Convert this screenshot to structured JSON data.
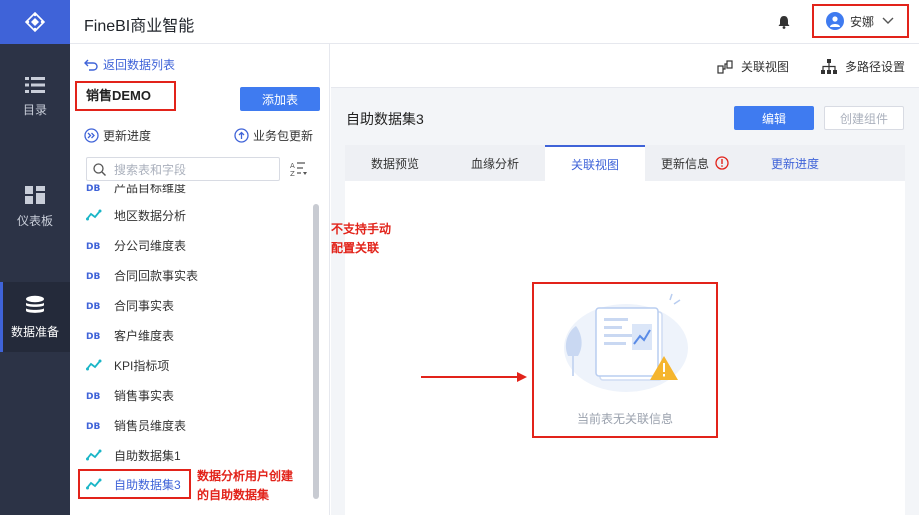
{
  "app": {
    "title": "FineBI商业智能"
  },
  "user": {
    "name": "安娜"
  },
  "nav": [
    {
      "label": "目录",
      "icon": "list-icon"
    },
    {
      "label": "仪表板",
      "icon": "dashboard-icon"
    },
    {
      "label": "数据准备",
      "icon": "database-icon"
    }
  ],
  "left_panel": {
    "back_label": "返回数据列表",
    "package_name": "销售DEMO",
    "add_table_label": "添加表",
    "update_progress_label": "更新进度",
    "package_update_label": "业务包更新",
    "search_placeholder": "搜索表和字段",
    "tables": [
      {
        "name": "产品目标维度",
        "type": "db"
      },
      {
        "name": "地区数据分析",
        "type": "self-service"
      },
      {
        "name": "分公司维度表",
        "type": "db"
      },
      {
        "name": "合同回款事实表",
        "type": "db"
      },
      {
        "name": "合同事实表",
        "type": "db"
      },
      {
        "name": "客户维度表",
        "type": "db"
      },
      {
        "name": "KPI指标项",
        "type": "self-service"
      },
      {
        "name": "销售事实表",
        "type": "db"
      },
      {
        "name": "销售员维度表",
        "type": "db"
      },
      {
        "name": "自助数据集1",
        "type": "self-service"
      },
      {
        "name": "自助数据集3",
        "type": "self-service",
        "selected": true
      }
    ]
  },
  "main": {
    "relation_view_label": "关联视图",
    "multi_path_label": "多路径设置",
    "dataset_title": "自助数据集3",
    "edit_label": "编辑",
    "create_component_label": "创建组件",
    "tabs": [
      "数据预览",
      "血缘分析",
      "关联视图",
      "更新信息",
      "更新进度"
    ],
    "active_tab": "关联视图",
    "empty_message": "当前表无关联信息"
  },
  "annotations": {
    "note_manual_line1": "不支持手动",
    "note_manual_line2": "配置关联",
    "note_user_line1": "数据分析用户创建",
    "note_user_line2": "的自助数据集"
  },
  "colors": {
    "accent": "#3f63d8",
    "button": "#3f7bf0",
    "annotation_red": "#e2231a",
    "nav_bg": "#2c3346"
  }
}
